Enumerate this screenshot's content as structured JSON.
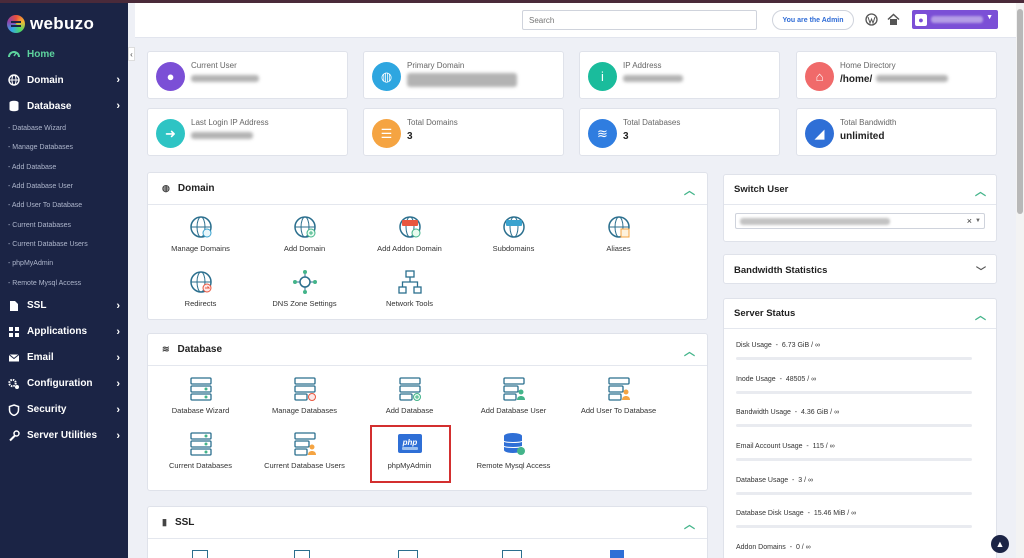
{
  "brand": {
    "name": "webuzo"
  },
  "sidebar": {
    "items": [
      {
        "label": "Home",
        "icon": "dashboard-icon",
        "active": true
      },
      {
        "label": "Domain",
        "icon": "globe-icon"
      },
      {
        "label": "Database",
        "icon": "database-icon"
      }
    ],
    "subitems": [
      "- Database Wizard",
      "- Manage Databases",
      "- Add Database",
      "- Add Database User",
      "- Add User To Database",
      "- Current Databases",
      "- Current Database Users",
      "- phpMyAdmin",
      "- Remote Mysql Access"
    ],
    "items2": [
      {
        "label": "SSL",
        "icon": "file-icon"
      },
      {
        "label": "Applications",
        "icon": "grid-icon"
      },
      {
        "label": "Email",
        "icon": "envelope-icon"
      },
      {
        "label": "Configuration",
        "icon": "cogs-icon"
      },
      {
        "label": "Security",
        "icon": "shield-icon"
      },
      {
        "label": "Server Utilities",
        "icon": "wrench-icon"
      }
    ]
  },
  "topbar": {
    "search_placeholder": "Search",
    "admin_badge": "You are the Admin"
  },
  "info_cards": [
    {
      "label": "Current User",
      "value": "",
      "color": "#7b4fd6"
    },
    {
      "label": "Primary Domain",
      "value": "",
      "color": "#2ea6e0"
    },
    {
      "label": "IP Address",
      "value": "",
      "color": "#1abc9c"
    },
    {
      "label": "Home Directory",
      "value": "/home/",
      "color": "#f06a6a"
    },
    {
      "label": "Last Login IP Address",
      "value": "",
      "color": "#2ec4c4"
    },
    {
      "label": "Total Domains",
      "value": "3",
      "color": "#f5a442"
    },
    {
      "label": "Total Databases",
      "value": "3",
      "color": "#2f7de0"
    },
    {
      "label": "Total Bandwidth",
      "value": "unlimited",
      "color": "#2f6fd6"
    }
  ],
  "domain_panel": {
    "title": "Domain",
    "tiles": [
      "Manage Domains",
      "Add Domain",
      "Add Addon Domain",
      "Subdomains",
      "Aliases",
      "Redirects",
      "DNS Zone Settings",
      "Network Tools"
    ]
  },
  "database_panel": {
    "title": "Database",
    "tiles": [
      "Database Wizard",
      "Manage Databases",
      "Add Database",
      "Add Database User",
      "Add User To Database",
      "Current Databases",
      "Current Database Users",
      "phpMyAdmin",
      "Remote Mysql Access"
    ]
  },
  "ssl_panel": {
    "title": "SSL"
  },
  "switch_user": {
    "title": "Switch User"
  },
  "bandwidth": {
    "title": "Bandwidth Statistics"
  },
  "server_status": {
    "title": "Server Status",
    "stats": [
      {
        "label": "Disk Usage",
        "value": "6.73 GiB / ∞"
      },
      {
        "label": "Inode Usage",
        "value": "48505 / ∞"
      },
      {
        "label": "Bandwidth Usage",
        "value": "4.36 GiB / ∞"
      },
      {
        "label": "Email Account Usage",
        "value": "115 / ∞"
      },
      {
        "label": "Database Usage",
        "value": "3 / ∞"
      },
      {
        "label": "Database Disk Usage",
        "value": "15.46 MiB / ∞"
      },
      {
        "label": "Addon Domains",
        "value": "0 / ∞"
      }
    ]
  }
}
